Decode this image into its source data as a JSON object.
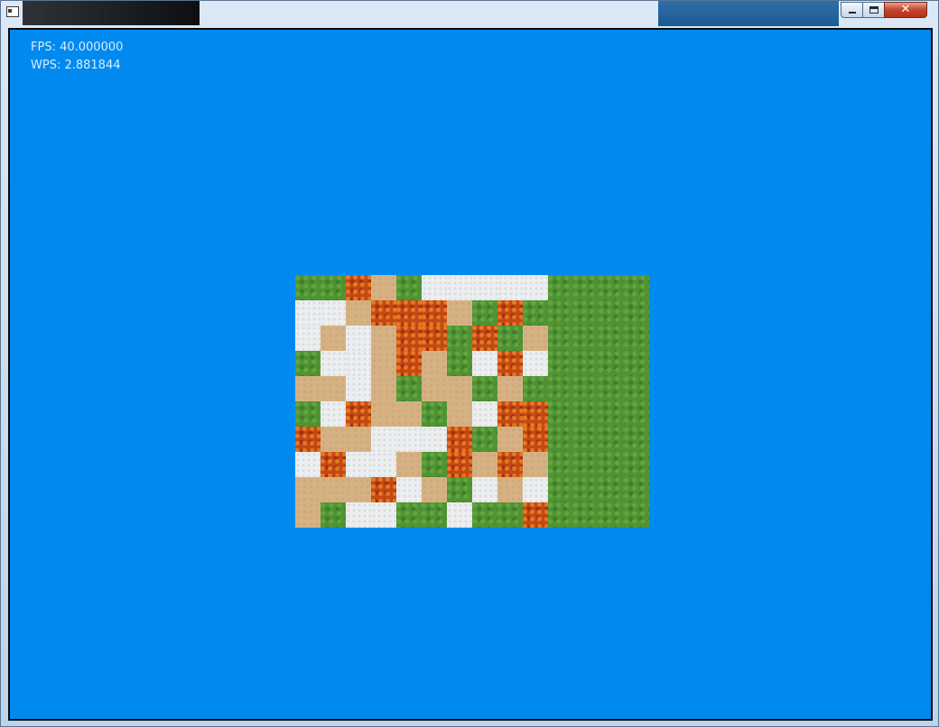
{
  "hud": {
    "fps_label": "FPS: 40.000000",
    "wps_label": "WPS: 2.881844"
  },
  "colors": {
    "viewport_background": "#008aef",
    "grass": "#4f9334",
    "sand": "#d6b184",
    "snow": "#eceeef",
    "lava": "#c44815"
  },
  "tile_legend": {
    "G": "grass",
    "S": "sand",
    "W": "snow",
    "L": "lava"
  },
  "map": {
    "columns": 14,
    "rows": [
      "GGLSGWWWWWGGGG",
      "WWSLLLSGLGGGGG",
      "WSWSLLGLGSGGGG",
      "GWWSLSGWLWGGGG",
      "SSWSGSSGSGGGGG",
      "GWLSSGSWLLGGGG",
      "LSSWWWLGSLGGGG",
      "WLWWSGLSLSGGGG",
      "SSSLWSGWSWGGGG",
      "SGWWGGWGGLGGGG"
    ]
  }
}
